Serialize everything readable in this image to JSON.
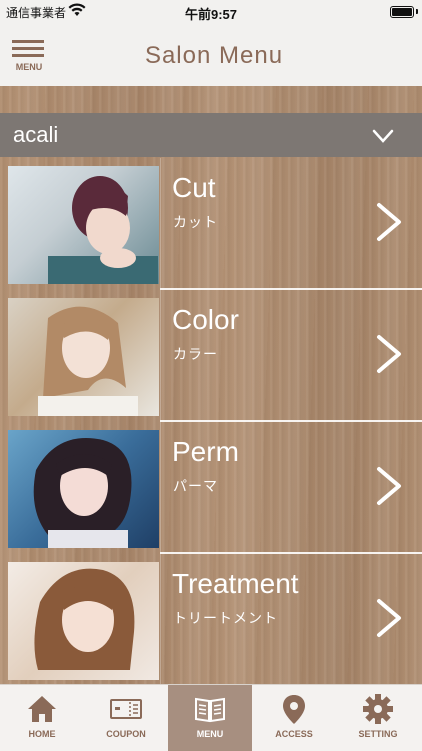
{
  "status_bar": {
    "carrier": "通信事業者",
    "time": "午前9:57"
  },
  "header": {
    "menu_label": "MENU",
    "title": "Salon Menu"
  },
  "salon_selector": {
    "selected": "acali"
  },
  "menu_items": [
    {
      "en": "Cut",
      "ja": "カット",
      "photo": "photo-cut"
    },
    {
      "en": "Color",
      "ja": "カラー",
      "photo": "photo-color"
    },
    {
      "en": "Perm",
      "ja": "パーマ",
      "photo": "photo-perm"
    },
    {
      "en": "Treatment",
      "ja": "トリートメント",
      "photo": "photo-treat"
    }
  ],
  "tabs": [
    {
      "label": "HOME",
      "icon": "home-icon"
    },
    {
      "label": "COUPON",
      "icon": "coupon-icon"
    },
    {
      "label": "MENU",
      "icon": "book-icon",
      "active": true
    },
    {
      "label": "ACCESS",
      "icon": "map-pin-icon"
    },
    {
      "label": "SETTING",
      "icon": "gear-icon"
    }
  ],
  "colors": {
    "brand_brown": "#8a6a58",
    "selector_gray": "#7d7773",
    "active_tab": "#a78f80"
  }
}
